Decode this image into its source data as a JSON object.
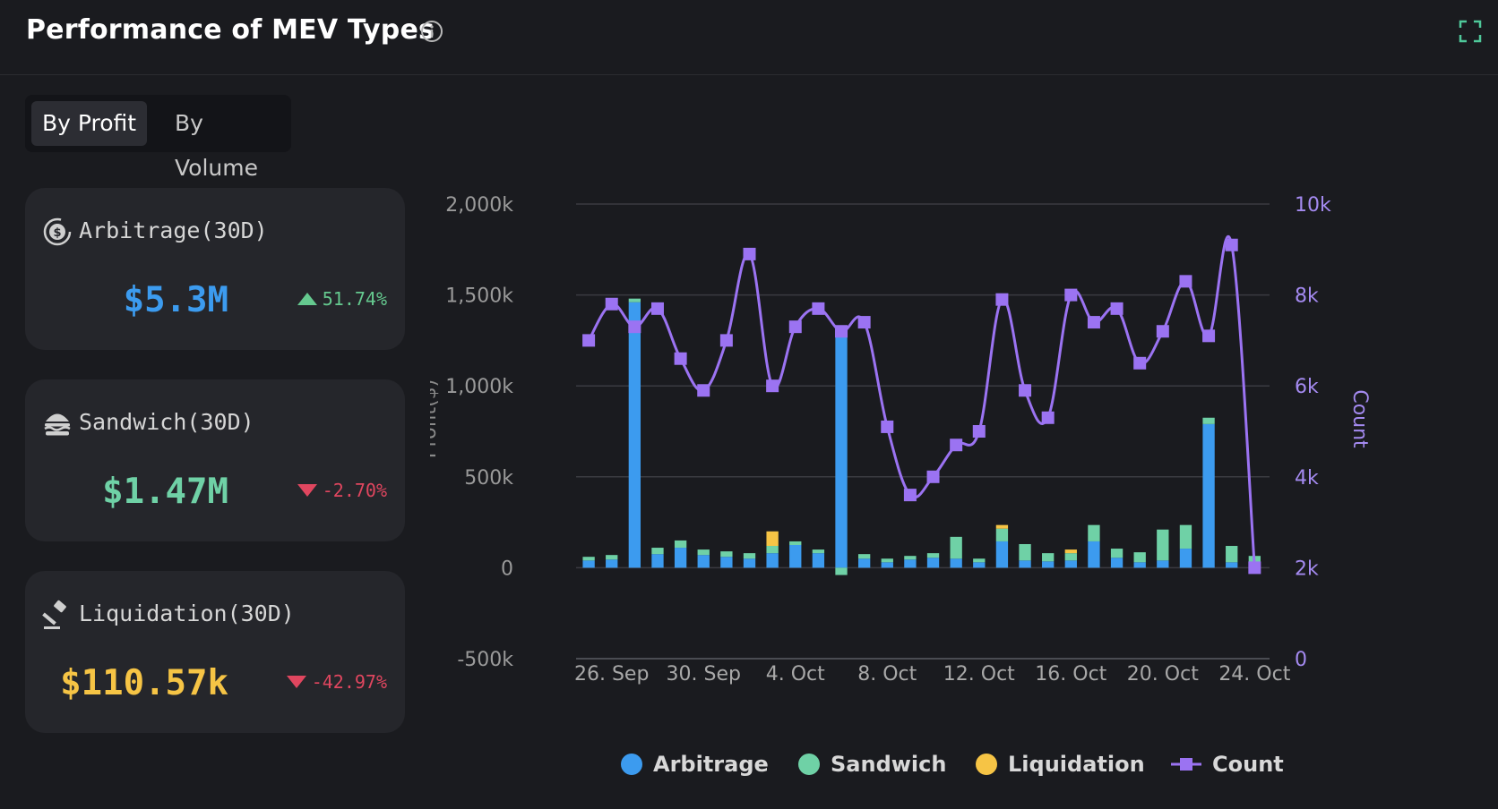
{
  "header": {
    "title": "Performance of MEV Types",
    "info_icon": "info-circle-icon",
    "expand_icon": "expand-icon"
  },
  "tabs": [
    {
      "label": "By Profit",
      "active": true
    },
    {
      "label": "By Volume",
      "active": false
    }
  ],
  "cards": [
    {
      "icon": "dollar-cycle-icon",
      "label": "Arbitrage(30D)",
      "value": "$5.3M",
      "value_color": "#3c9bef",
      "change": "51.74%",
      "direction": "up",
      "change_color": "#65c98f"
    },
    {
      "icon": "sandwich-icon",
      "label": "Sandwich(30D)",
      "value": "$1.47M",
      "value_color": "#6fd1a6",
      "change": "-2.70%",
      "direction": "down",
      "change_color": "#e0465f"
    },
    {
      "icon": "gavel-icon",
      "label": "Liquidation(30D)",
      "value": "$110.57k",
      "value_color": "#f6c445",
      "change": "-42.97%",
      "direction": "down",
      "change_color": "#e0465f"
    }
  ],
  "chart_data": {
    "type": "bar",
    "ylabel": "Profit($)",
    "y2label": "Count",
    "ylim": [
      -500000,
      2000000
    ],
    "y2lim": [
      0,
      10000
    ],
    "y_ticks": [
      "2,000k",
      "1,500k",
      "1,000k",
      "500k",
      "0",
      "-500k"
    ],
    "y2_ticks": [
      "10k",
      "8k",
      "6k",
      "4k",
      "2k",
      "0"
    ],
    "x_ticks": [
      "26. Sep",
      "30. Sep",
      "4. Oct",
      "8. Oct",
      "12. Oct",
      "16. Oct",
      "20. Oct",
      "24. Oct"
    ],
    "dates": [
      "25. Sep",
      "26. Sep",
      "27. Sep",
      "28. Sep",
      "29. Sep",
      "30. Sep",
      "1. Oct",
      "2. Oct",
      "3. Oct",
      "4. Oct",
      "5. Oct",
      "6. Oct",
      "7. Oct",
      "8. Oct",
      "9. Oct",
      "10. Oct",
      "11. Oct",
      "12. Oct",
      "13. Oct",
      "14. Oct",
      "15. Oct",
      "16. Oct",
      "17. Oct",
      "18. Oct",
      "19. Oct",
      "20. Oct",
      "21. Oct",
      "22. Oct",
      "23. Oct",
      "24. Oct"
    ],
    "series": [
      {
        "name": "Arbitrage",
        "color": "#3c9bef",
        "values": [
          40000,
          45000,
          1460000,
          75000,
          110000,
          70000,
          60000,
          50000,
          80000,
          125000,
          80000,
          1300000,
          50000,
          30000,
          45000,
          55000,
          50000,
          30000,
          145000,
          40000,
          35000,
          40000,
          145000,
          55000,
          30000,
          40000,
          105000,
          790000,
          30000,
          20000
        ]
      },
      {
        "name": "Sandwich",
        "color": "#6fd1a6",
        "values": [
          20000,
          25000,
          20000,
          35000,
          40000,
          30000,
          30000,
          30000,
          40000,
          20000,
          20000,
          -40000,
          25000,
          20000,
          20000,
          25000,
          120000,
          20000,
          70000,
          90000,
          45000,
          40000,
          90000,
          50000,
          55000,
          170000,
          130000,
          35000,
          90000,
          45000
        ]
      },
      {
        "name": "Liquidation",
        "color": "#f6c445",
        "values": [
          0,
          0,
          0,
          0,
          0,
          0,
          0,
          0,
          80000,
          0,
          0,
          0,
          0,
          0,
          0,
          0,
          0,
          0,
          20000,
          0,
          0,
          20000,
          0,
          0,
          0,
          0,
          0,
          0,
          0,
          0
        ]
      },
      {
        "name": "Count",
        "color": "#9b73f2",
        "values": [
          7000,
          7800,
          7300,
          7700,
          6600,
          5900,
          7000,
          8900,
          6000,
          7300,
          7700,
          7200,
          7400,
          5100,
          3600,
          4000,
          4700,
          5000,
          7900,
          5900,
          5300,
          8000,
          7400,
          7700,
          6500,
          7200,
          8300,
          7100,
          9100,
          2000
        ]
      }
    ],
    "legend": [
      "Arbitrage",
      "Sandwich",
      "Liquidation",
      "Count"
    ],
    "legend_position": "bottom",
    "grid": true
  }
}
